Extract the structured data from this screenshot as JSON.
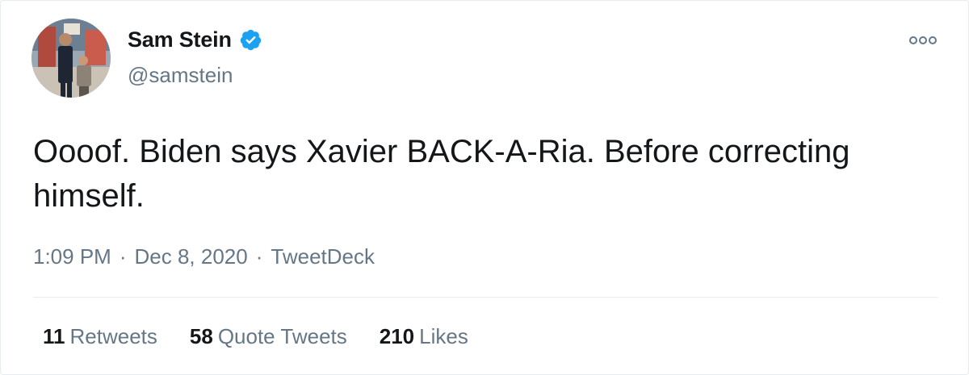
{
  "author": {
    "display_name": "Sam Stein",
    "handle": "@samstein",
    "verified": true,
    "verified_color": "#1da1f2",
    "avatar_icon": "profile-photo"
  },
  "more_icon": "ellipsis-icon",
  "tweet": {
    "text": "Oooof. Biden says Xavier BACK-A-Ria. Before correcting himself.",
    "time": "1:09 PM",
    "date": "Dec 8, 2020",
    "source": "TweetDeck",
    "separator": "·"
  },
  "stats": [
    {
      "count": "11",
      "label": "Retweets"
    },
    {
      "count": "58",
      "label": "Quote Tweets"
    },
    {
      "count": "210",
      "label": "Likes"
    }
  ],
  "colors": {
    "text_primary": "#14171a",
    "text_secondary": "#657786",
    "divider": "#e6ecf0"
  }
}
